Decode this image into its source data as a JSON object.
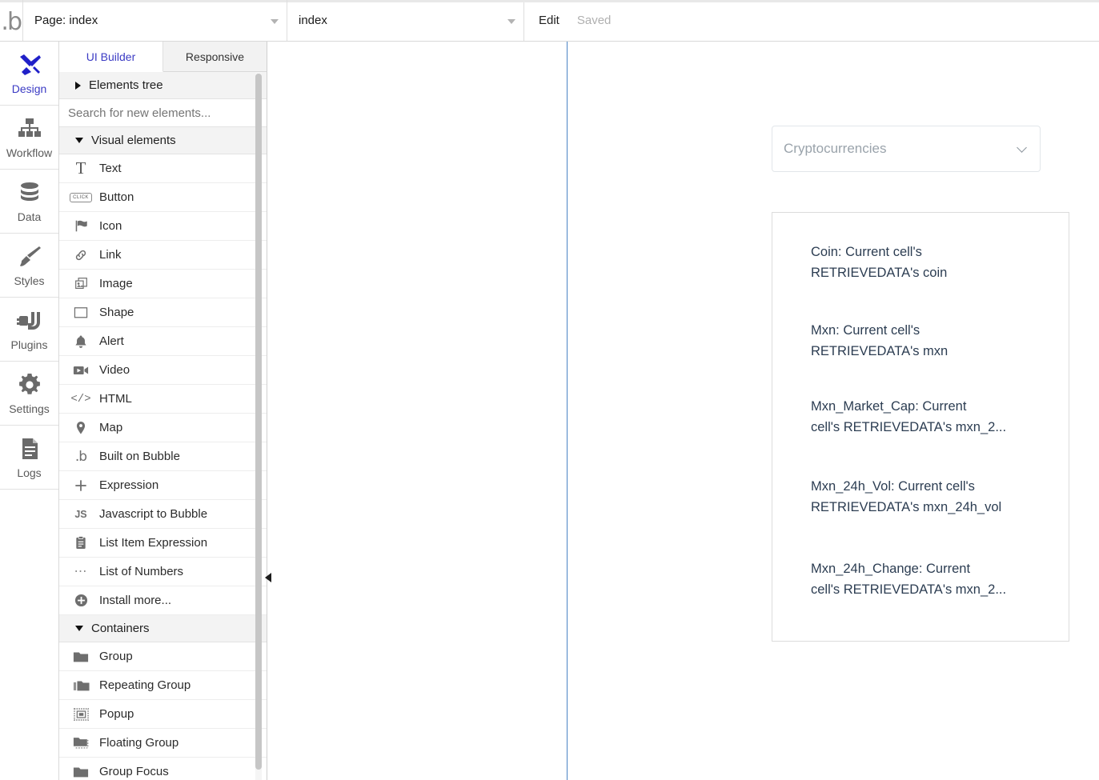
{
  "topbar": {
    "logo": "bubble-logo",
    "page_selector": {
      "label": "Page: index",
      "caret_icon": "caret-down-icon"
    },
    "element_selector": {
      "label": "index",
      "caret_icon": "caret-down-icon"
    },
    "edit_label": "Edit",
    "status_label": "Saved"
  },
  "rail": {
    "items": [
      {
        "label": "Design",
        "icon": "design-pencil-ruler-icon",
        "active": true
      },
      {
        "label": "Workflow",
        "icon": "workflow-hierarchy-icon",
        "active": false
      },
      {
        "label": "Data",
        "icon": "database-icon",
        "active": false
      },
      {
        "label": "Styles",
        "icon": "paintbrush-icon",
        "active": false
      },
      {
        "label": "Plugins",
        "icon": "plug-icon",
        "active": false
      },
      {
        "label": "Settings",
        "icon": "gear-icon",
        "active": false
      },
      {
        "label": "Logs",
        "icon": "document-lines-icon",
        "active": false
      }
    ]
  },
  "panel": {
    "tabs": [
      {
        "label": "UI Builder",
        "active": true
      },
      {
        "label": "Responsive",
        "active": false
      }
    ],
    "elements_tree": {
      "label": "Elements tree",
      "expanded": false,
      "icon": "triangle-right-icon"
    },
    "search": {
      "placeholder": "Search for new elements...",
      "value": ""
    },
    "sections": [
      {
        "label": "Visual elements",
        "expanded": true,
        "icon": "triangle-down-icon",
        "items": [
          {
            "label": "Text",
            "icon": "text-T-icon"
          },
          {
            "label": "Button",
            "icon": "button-click-icon"
          },
          {
            "label": "Icon",
            "icon": "flag-icon"
          },
          {
            "label": "Link",
            "icon": "link-chain-icon"
          },
          {
            "label": "Image",
            "icon": "image-icon"
          },
          {
            "label": "Shape",
            "icon": "square-shape-icon"
          },
          {
            "label": "Alert",
            "icon": "bell-icon"
          },
          {
            "label": "Video",
            "icon": "video-camera-icon"
          },
          {
            "label": "HTML",
            "icon": "code-brackets-icon"
          },
          {
            "label": "Map",
            "icon": "map-pin-icon"
          },
          {
            "label": "Built on Bubble",
            "icon": "bubble-b-icon"
          },
          {
            "label": "Expression",
            "icon": "plus-icon"
          },
          {
            "label": "Javascript to Bubble",
            "icon": "js-icon"
          },
          {
            "label": "List Item Expression",
            "icon": "clipboard-icon"
          },
          {
            "label": "List of Numbers",
            "icon": "ellipsis-icon"
          },
          {
            "label": "Install more...",
            "icon": "plus-circle-icon"
          }
        ]
      },
      {
        "label": "Containers",
        "expanded": true,
        "icon": "triangle-down-icon",
        "items": [
          {
            "label": "Group",
            "icon": "folder-icon"
          },
          {
            "label": "Repeating Group",
            "icon": "folder-stack-icon"
          },
          {
            "label": "Popup",
            "icon": "popup-frame-icon"
          },
          {
            "label": "Floating Group",
            "icon": "folder-dashed-icon"
          },
          {
            "label": "Group Focus",
            "icon": "folder-focus-icon"
          }
        ]
      }
    ],
    "scrollbar": "vertical-scrollbar",
    "collapse_handle_icon": "triangle-left-icon"
  },
  "canvas": {
    "guide_line_color": "#4b84c4",
    "dropdown": {
      "placeholder": "Cryptocurrencies",
      "chevron_icon": "chevron-down-icon"
    },
    "repeating_group": {
      "cells": [
        {
          "text": "Coin: Current cell's\nRETRIEVEDATA's coin"
        },
        {
          "text": "Mxn: Current cell's\nRETRIEVEDATA's mxn"
        },
        {
          "text": "Mxn_Market_Cap: Current\ncell's RETRIEVEDATA's mxn_2..."
        },
        {
          "text": "Mxn_24h_Vol: Current cell's\nRETRIEVEDATA's mxn_24h_vol"
        },
        {
          "text": "Mxn_24h_Change: Current\ncell's RETRIEVEDATA's mxn_2..."
        }
      ]
    }
  },
  "colors": {
    "accent": "#3b3bc4",
    "guide": "#4b84c4",
    "canvas_text": "#2c3d52",
    "muted": "#9aa3ab"
  }
}
